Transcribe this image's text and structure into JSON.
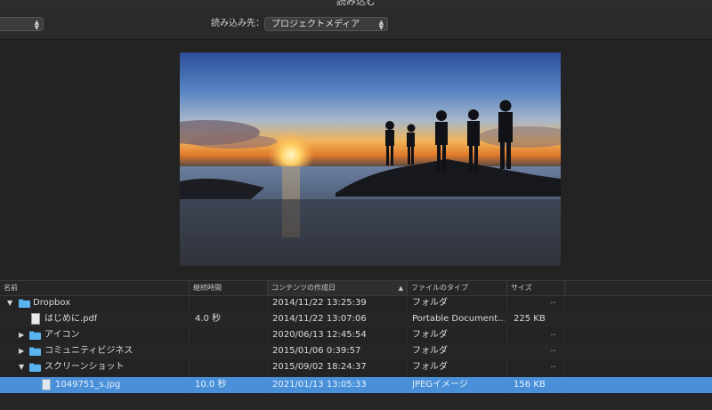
{
  "window": {
    "title": "読み込む"
  },
  "toolbar": {
    "left_popup_value": "",
    "dest_label": "読み込み先：",
    "dest_value": "プロジェクトメディア"
  },
  "table": {
    "columns": [
      "名前",
      "継続時間",
      "コンテンツの作成日",
      "ファイルのタイプ",
      "サイズ"
    ],
    "sorted_column_index": 2,
    "sort_direction": "ascending",
    "rows": [
      {
        "name": "Dropbox",
        "kind": "folder",
        "disclosure": "expanded",
        "duration": "",
        "date": "2014/11/22 13:25:39",
        "type": "フォルダ",
        "size": "--"
      },
      {
        "name": "はじめに.pdf",
        "kind": "pdf",
        "disclosure": "none",
        "duration": "4.0 秒",
        "date": "2014/11/22 13:07:06",
        "type": "Portable Document...",
        "size": "225 KB"
      },
      {
        "name": "アイコン",
        "kind": "folder",
        "disclosure": "collapsed",
        "duration": "",
        "date": "2020/06/13 12:45:54",
        "type": "フォルダ",
        "size": "--"
      },
      {
        "name": "コミュニティビジネス",
        "kind": "folder",
        "disclosure": "collapsed",
        "duration": "",
        "date": "2015/01/06 0:39:57",
        "type": "フォルダ",
        "size": "--"
      },
      {
        "name": "スクリーンショット",
        "kind": "folder",
        "disclosure": "expanded",
        "duration": "",
        "date": "2015/09/02 18:24:37",
        "type": "フォルダ",
        "size": "--"
      },
      {
        "name": "1049751_s.jpg",
        "kind": "image",
        "disclosure": "none",
        "duration": "10.0 秒",
        "date": "2021/01/13 13:05:33",
        "type": "JPEGイメージ",
        "size": "156 KB",
        "selected": true
      }
    ]
  },
  "icons": {
    "folder": "folder-icon",
    "pdf": "pdf-file-icon",
    "image": "jpeg-file-icon",
    "expanded": "disclosure-triangle-down-icon",
    "collapsed": "disclosure-triangle-right-icon",
    "sort": "sort-ascending-icon",
    "popup": "popup-arrows-icon"
  },
  "colors": {
    "selection": "#4a90d9",
    "folder": "#5bb4f0",
    "background": "#232323"
  }
}
